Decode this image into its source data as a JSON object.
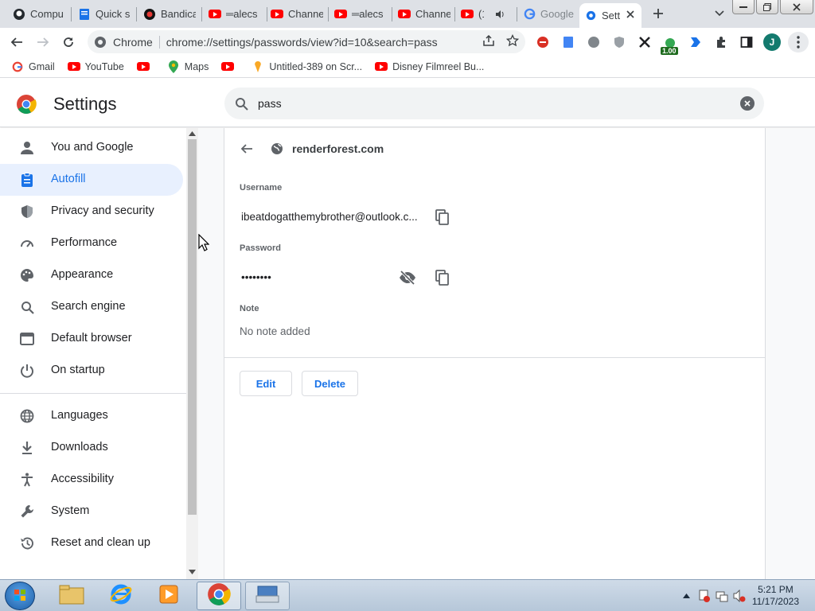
{
  "browser": {
    "tabs": [
      {
        "label": "Compu",
        "icon": "github-icon"
      },
      {
        "label": "Quick s",
        "icon": "doc-icon"
      },
      {
        "label": "Bandica",
        "icon": "bandicam-icon"
      },
      {
        "label": "═alecs",
        "icon": "youtube-icon"
      },
      {
        "label": "Channe",
        "icon": "youtube-icon"
      },
      {
        "label": "═alecs",
        "icon": "youtube-icon"
      },
      {
        "label": "Channe",
        "icon": "youtube-icon"
      },
      {
        "label": "(1)",
        "icon": "youtube-icon"
      },
      {
        "label": "Google",
        "icon": "google-icon"
      },
      {
        "label": "Sett",
        "icon": "gear-icon",
        "active": true
      }
    ],
    "omnibox": {
      "site_label": "Chrome",
      "url": "chrome://settings/passwords/view?id=10&search=pass"
    },
    "extensions": {
      "badge": "1.00",
      "avatar_letter": "J"
    },
    "bookmarks": [
      {
        "label": "Gmail",
        "icon": "google-icon"
      },
      {
        "label": "YouTube",
        "icon": "youtube-icon"
      },
      {
        "label": "",
        "icon": "youtube-icon"
      },
      {
        "label": "Maps",
        "icon": "maps-icon"
      },
      {
        "label": "",
        "icon": "youtube-icon"
      },
      {
        "label": "Untitled-389 on Scr...",
        "icon": "scratch-icon"
      },
      {
        "label": "Disney Filmreel Bu...",
        "icon": "youtube-icon"
      }
    ]
  },
  "settings": {
    "title": "Settings",
    "search_query": "pass",
    "nav": [
      {
        "label": "You and Google",
        "icon": "person-icon"
      },
      {
        "label": "Autofill",
        "icon": "clipboard-icon",
        "selected": true
      },
      {
        "label": "Privacy and security",
        "icon": "shield-icon"
      },
      {
        "label": "Performance",
        "icon": "speedometer-icon"
      },
      {
        "label": "Appearance",
        "icon": "palette-icon"
      },
      {
        "label": "Search engine",
        "icon": "search-icon"
      },
      {
        "label": "Default browser",
        "icon": "browser-icon"
      },
      {
        "label": "On startup",
        "icon": "power-icon"
      },
      {
        "label": "Languages",
        "icon": "globe-icon"
      },
      {
        "label": "Downloads",
        "icon": "download-icon"
      },
      {
        "label": "Accessibility",
        "icon": "accessibility-icon"
      },
      {
        "label": "System",
        "icon": "wrench-icon"
      },
      {
        "label": "Reset and clean up",
        "icon": "history-icon"
      }
    ],
    "password_detail": {
      "site": "renderforest.com",
      "username_label": "Username",
      "username": "ibeatdogatthemybrother@outlook.c...",
      "password_label": "Password",
      "password_masked": "••••••••",
      "note_label": "Note",
      "note_empty": "No note added",
      "edit_label": "Edit",
      "delete_label": "Delete"
    }
  },
  "taskbar": {
    "time": "5:21 PM",
    "date": "11/17/2023"
  }
}
